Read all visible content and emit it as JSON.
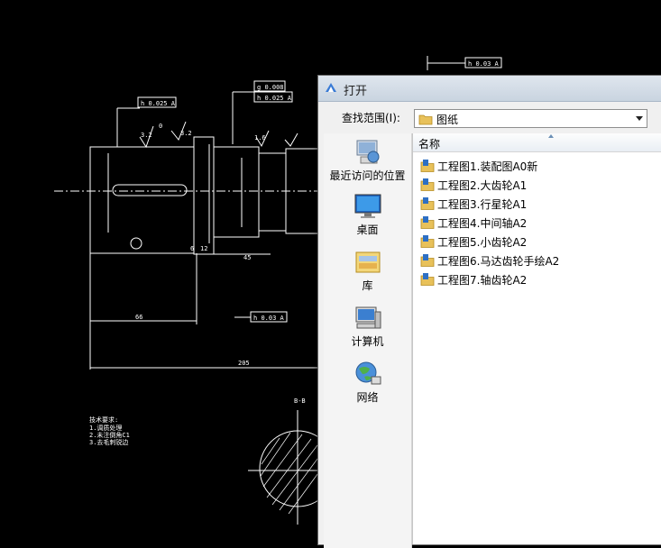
{
  "cad": {
    "tol_boxes": [
      {
        "sym": "h",
        "val": "0.025",
        "ref": "A"
      },
      {
        "sym": "g",
        "val": "0.008",
        "ref": ""
      },
      {
        "sym": "h",
        "val": "0.025",
        "ref": "A"
      },
      {
        "sym": "h",
        "val": "0.03",
        "ref": "A"
      },
      {
        "sym": "h",
        "val": "0.03",
        "ref": "A"
      }
    ],
    "dims": {
      "d66": "66",
      "d205": "205",
      "d45": "45",
      "d6": "6",
      "d12": "12",
      "d32a": "3.2",
      "d32b": "3.2",
      "d16": "1.6",
      "d0": "0",
      "section": "B-B"
    },
    "notes": [
      "技术要求:",
      "1.调质处理",
      "2.未注倒角C1",
      "3.去毛刺锐边"
    ]
  },
  "dialog": {
    "title": "打开",
    "lookin_label": "查找范围(I):",
    "lookin_value": "图纸",
    "column_header": "名称",
    "places": [
      "最近访问的位置",
      "桌面",
      "库",
      "计算机",
      "网络"
    ],
    "files": [
      "工程图1.装配图A0新",
      "工程图2.大齿轮A1",
      "工程图3.行星轮A1",
      "工程图4.中间轴A2",
      "工程图5.小齿轮A2",
      "工程图6.马达齿轮手绘A2",
      "工程图7.轴齿轮A2"
    ]
  },
  "colors": {
    "cad_background": "#000000",
    "cad_line": "#ffffff",
    "dialog_bg": "#f0f0f0",
    "folder_yellow": "#e8c15a"
  }
}
